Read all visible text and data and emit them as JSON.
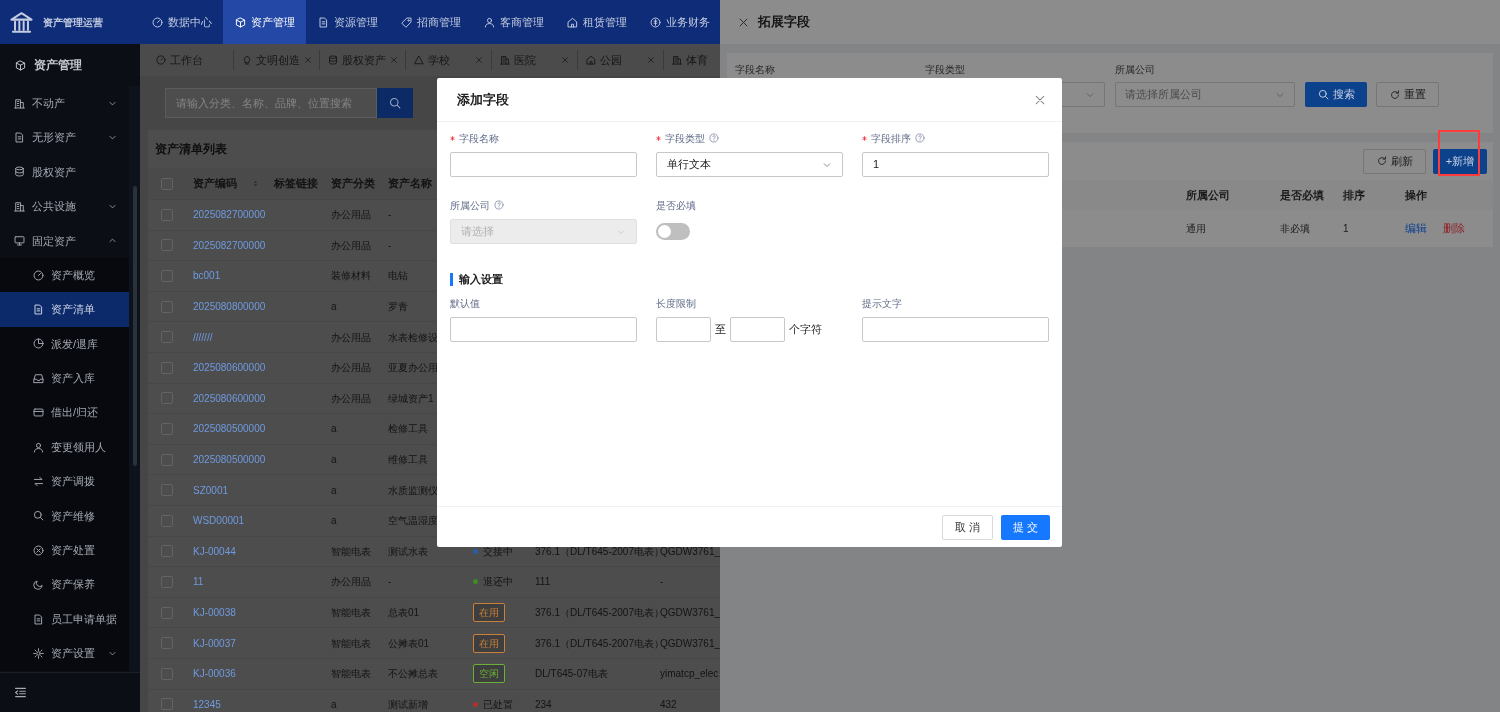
{
  "brand": {
    "title": "资产管理运营"
  },
  "top_nav": [
    {
      "label": "数据中心",
      "selected": false
    },
    {
      "label": "资产管理",
      "selected": true
    },
    {
      "label": "资源管理",
      "selected": false
    },
    {
      "label": "招商管理",
      "selected": false
    },
    {
      "label": "客商管理",
      "selected": false
    },
    {
      "label": "租赁管理",
      "selected": false
    },
    {
      "label": "业务财务",
      "selected": false
    }
  ],
  "sidebar": {
    "title": "资产管理",
    "items": [
      {
        "label": "不动产",
        "kind": "group",
        "expanded": false,
        "selected": false
      },
      {
        "label": "无形资产",
        "kind": "group",
        "expanded": false,
        "selected": false
      },
      {
        "label": "股权资产",
        "kind": "link",
        "selected": false
      },
      {
        "label": "公共设施",
        "kind": "group",
        "expanded": false,
        "selected": false
      },
      {
        "label": "固定资产",
        "kind": "group",
        "expanded": true,
        "selected": false,
        "children": [
          {
            "label": "资产概览",
            "kind": "link",
            "selected": false
          },
          {
            "label": "资产清单",
            "kind": "link",
            "selected": true
          },
          {
            "label": "派发/退库",
            "kind": "link",
            "selected": false
          },
          {
            "label": "资产入库",
            "kind": "link",
            "selected": false
          },
          {
            "label": "借出/归还",
            "kind": "link",
            "selected": false
          },
          {
            "label": "变更领用人",
            "kind": "link",
            "selected": false
          },
          {
            "label": "资产调拨",
            "kind": "link",
            "selected": false
          },
          {
            "label": "资产维修",
            "kind": "link",
            "selected": false
          },
          {
            "label": "资产处置",
            "kind": "link",
            "selected": false
          },
          {
            "label": "资产保养",
            "kind": "link",
            "selected": false
          },
          {
            "label": "员工申请单据",
            "kind": "link",
            "selected": false
          },
          {
            "label": "资产设置",
            "kind": "group",
            "expanded": false,
            "selected": false
          }
        ]
      }
    ]
  },
  "tabs": [
    {
      "label": "工作台",
      "closable": false
    },
    {
      "label": "文明创造",
      "closable": true
    },
    {
      "label": "股权资产",
      "closable": true
    },
    {
      "label": "学校",
      "closable": true
    },
    {
      "label": "医院",
      "closable": true
    },
    {
      "label": "公园",
      "closable": true
    },
    {
      "label": "体育"
    }
  ],
  "search": {
    "placeholder": "请输入分类、名称、品牌、位置搜索"
  },
  "table": {
    "title": "资产清单列表",
    "all_checked": false,
    "columns": [
      {
        "label": "资产编码",
        "sortable": true
      },
      {
        "label": "标签链接",
        "sortable": false
      },
      {
        "label": "资产分类",
        "sortable": false
      },
      {
        "label": "资产名称"
      }
    ],
    "rows": [
      {
        "checked": false,
        "code": "2025082700000",
        "category": "办公用品",
        "name": "-"
      },
      {
        "checked": false,
        "code": "2025082700000",
        "category": "办公用品",
        "name": "-"
      },
      {
        "checked": false,
        "code": "bc001",
        "category": "装修材料",
        "name": "电钻"
      },
      {
        "checked": false,
        "code": "2025080800000",
        "category": "a",
        "name": "罗青"
      },
      {
        "checked": false,
        "code": "///////",
        "category": "办公用品",
        "name": "水表检修设"
      },
      {
        "checked": false,
        "code": "2025080600000",
        "category": "办公用品",
        "name": "亚夏办公用"
      },
      {
        "checked": false,
        "code": "2025080600000",
        "category": "办公用品",
        "name": "绿城资产1"
      },
      {
        "checked": false,
        "code": "2025080500000",
        "category": "a",
        "name": "检修工具"
      },
      {
        "checked": false,
        "code": "2025080500000",
        "category": "a",
        "name": "维修工具"
      },
      {
        "checked": false,
        "code": "SZ0001",
        "category": "a",
        "name": "水质监测仪"
      },
      {
        "checked": false,
        "code": "WSD00001",
        "category": "a",
        "name": "空气温湿度"
      },
      {
        "checked": false,
        "code": "KJ-00044",
        "category": "智能电表",
        "name": "测试水表",
        "status": {
          "kind": "dot",
          "label": "交接中",
          "color": "#2a5ca8"
        },
        "column_6": "376.1（DL/T645-2007电表）",
        "column_7": "QGDW3761_"
      },
      {
        "checked": false,
        "code": "11",
        "category": "办公用品",
        "name": "-",
        "status": {
          "kind": "dot",
          "label": "退还中",
          "color": "#3f8a22"
        },
        "column_6": "111",
        "column_7": "-"
      },
      {
        "checked": false,
        "code": "KJ-00038",
        "category": "智能电表",
        "name": "总表01",
        "status": {
          "kind": "tag",
          "label": "在用",
          "color": "#c9803a"
        },
        "column_6": "376.1（DL/T645-2007电表）",
        "column_7": "QGDW3761_"
      },
      {
        "checked": false,
        "code": "KJ-00037",
        "category": "智能电表",
        "name": "公摊表01",
        "status": {
          "kind": "tag",
          "label": "在用",
          "color": "#c9803a"
        },
        "column_6": "376.1（DL/T645-2007电表）",
        "column_7": "QGDW3761_"
      },
      {
        "checked": false,
        "code": "KJ-00036",
        "category": "智能电表",
        "name": "不公摊总表",
        "status": {
          "kind": "tag",
          "label": "空闲",
          "color": "#6aae3c"
        },
        "column_6": "DL/T645-07电表",
        "column_7": "yimatcp_elec"
      },
      {
        "checked": false,
        "code": "12345",
        "category": "a",
        "name": "测试新增",
        "status": {
          "kind": "dot",
          "label": "已处置",
          "color": "#b0302f"
        },
        "column_6": "234",
        "column_7": "432"
      }
    ]
  },
  "drawer": {
    "title": "拓展字段",
    "filters": [
      {
        "label": "字段名称",
        "kind": "input"
      },
      {
        "label": "字段类型",
        "kind": "select"
      },
      {
        "label": "所属公司",
        "kind": "select",
        "placeholder": "请选择所属公司"
      }
    ],
    "search_button": "搜索",
    "reset_button": "重置",
    "refresh_button": "刷新",
    "add_button": {
      "label": "+新增",
      "highlighted": true
    },
    "table": {
      "columns": [
        "所属公司",
        "是否必填",
        "排序",
        "操作"
      ],
      "rows": [
        {
          "company": "通用",
          "required": "非必填",
          "order": "1",
          "actions": [
            {
              "label": "编辑",
              "kind": "edit"
            },
            {
              "label": "删除",
              "kind": "delete"
            }
          ]
        }
      ]
    }
  },
  "modal": {
    "title": "添加字段",
    "fields": [
      {
        "label": "字段名称",
        "required": true,
        "help": false,
        "kind": "input",
        "disabled": false
      },
      {
        "label": "字段类型",
        "required": true,
        "help": true,
        "kind": "select",
        "value": "单行文本",
        "disabled": false
      },
      {
        "label": "字段排序",
        "required": true,
        "help": true,
        "kind": "input",
        "value": "1",
        "disabled": false
      },
      {
        "label": "所属公司",
        "required": false,
        "help": true,
        "kind": "select",
        "placeholder": "请选择",
        "disabled": true
      },
      {
        "label": "是否必填",
        "required": false,
        "help": false,
        "kind": "switch",
        "on": false
      }
    ],
    "section": "输入设置",
    "input_settings": [
      {
        "label": "默认值",
        "kind": "input"
      },
      {
        "label": "长度限制",
        "kind": "range",
        "separator": "至",
        "unit": "个字符"
      },
      {
        "label": "提示文字",
        "kind": "input"
      }
    ],
    "buttons": [
      {
        "label": "取 消",
        "primary": false
      },
      {
        "label": "提 交",
        "primary": true
      }
    ]
  }
}
